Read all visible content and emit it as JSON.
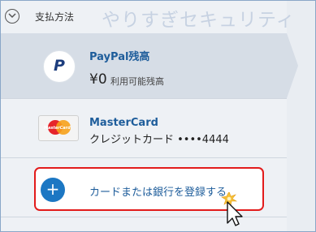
{
  "header": {
    "title": "支払方法",
    "watermark": "やりすぎセキュリティ"
  },
  "methods": [
    {
      "name": "PayPal残高",
      "balance": "¥0",
      "balance_label": "利用可能残高",
      "icon": "paypal-logo"
    },
    {
      "name": "MasterCard",
      "detail": "クレジットカード ••••4444",
      "icon": "mastercard-logo",
      "logo_text": "MasterCard"
    }
  ],
  "add": {
    "label": "カードまたは銀行を登録する",
    "icon": "plus-icon"
  },
  "colors": {
    "accent": "#1c77c3",
    "highlight_border": "#e21b1b",
    "link": "#1e5d9b"
  }
}
